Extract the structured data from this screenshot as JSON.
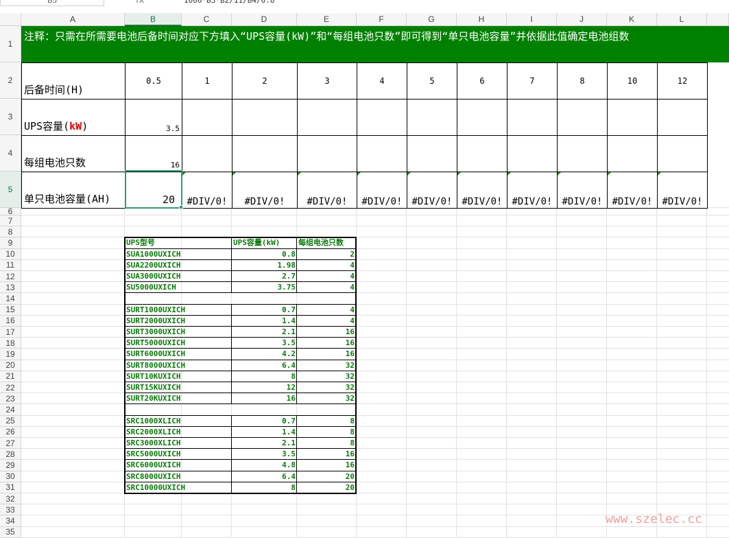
{
  "formula_bar": {
    "name_box": "B5",
    "fx": "fx",
    "formula": "1000*B3*B2/11/B4/0.8"
  },
  "columns": [
    "A",
    "B",
    "C",
    "D",
    "E",
    "F",
    "G",
    "H",
    "I",
    "J",
    "K",
    "L"
  ],
  "rows": [
    "1",
    "2",
    "3",
    "4",
    "5",
    "6",
    "7",
    "8",
    "9",
    "10",
    "11",
    "12",
    "13",
    "14",
    "15",
    "16",
    "17",
    "18",
    "19",
    "20",
    "21",
    "22",
    "23",
    "24",
    "25",
    "26",
    "27",
    "28",
    "29",
    "30",
    "31",
    "32",
    "33",
    "34",
    "35"
  ],
  "notice": "注释：只需在所需要电池后备时间对应下方填入“UPS容量(kW)”和“每组电池只数”即可得到“单只电池容量”并依据此值确定电池组数",
  "calc": {
    "label_time": "后备时间(H)",
    "label_ups_prefix": "UPS容量(",
    "label_ups_unit": "kW",
    "label_ups_suffix": ")",
    "label_count": "每组电池只数",
    "label_capacity": "单只电池容量(AH)",
    "hours": [
      "0.5",
      "1",
      "2",
      "3",
      "4",
      "5",
      "6",
      "7",
      "8",
      "10",
      "12"
    ],
    "ups_value": "3.5",
    "count_value": "16",
    "capacity_value": "20",
    "error_value": "#DIV/0!"
  },
  "model_table": {
    "headers": [
      "UPS型号",
      "UPS容量(kW)",
      "每组电池只数"
    ],
    "rows": [
      [
        "SUA1000UXICH",
        "0.8",
        "2"
      ],
      [
        "SUA2200UXICH",
        "1.98",
        "4"
      ],
      [
        "SUA3000UXICH",
        "2.7",
        "4"
      ],
      [
        "SU5000UXICH",
        "3.75",
        "4"
      ],
      [
        "",
        "",
        ""
      ],
      [
        "SURT1000UXICH",
        "0.7",
        "4"
      ],
      [
        "SURT2000UXICH",
        "1.4",
        "4"
      ],
      [
        "SURT3000UXICH",
        "2.1",
        "16"
      ],
      [
        "SURT5000UXICH",
        "3.5",
        "16"
      ],
      [
        "SURT6000UXICH",
        "4.2",
        "16"
      ],
      [
        "SURT8000UXICH",
        "6.4",
        "32"
      ],
      [
        "SURT10KUXICH",
        "8",
        "32"
      ],
      [
        "SURT15KUXICH",
        "12",
        "32"
      ],
      [
        "SURT20KUXICH",
        "16",
        "32"
      ],
      [
        "",
        "",
        ""
      ],
      [
        "SRC1000XLICH",
        "0.7",
        "8"
      ],
      [
        "SRC2000XLICH",
        "1.4",
        "8"
      ],
      [
        "SRC3000XLICH",
        "2.1",
        "8"
      ],
      [
        "SRC5000UXICH",
        "3.5",
        "16"
      ],
      [
        "SRC6000UXICH",
        "4.8",
        "16"
      ],
      [
        "SRC8000UXICH",
        "6.4",
        "20"
      ],
      [
        "SRC10000UXICH",
        "8",
        "20"
      ]
    ]
  },
  "watermark": "www.szelec.cc",
  "colors": {
    "header_green": "#008000",
    "text_green": "#0a7a0a",
    "selection": "#2e9a6a"
  }
}
